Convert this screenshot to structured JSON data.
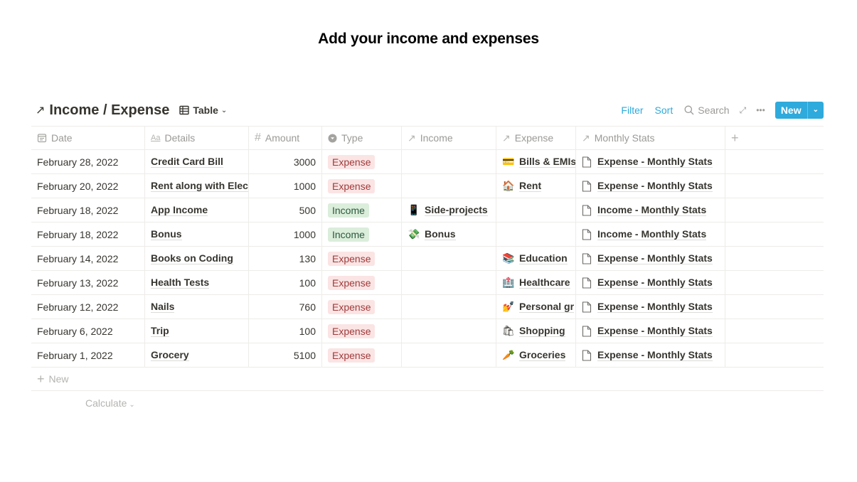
{
  "page_heading": "Add your income and expenses",
  "database": {
    "title": "Income / Expense",
    "view": {
      "label": "Table",
      "icon": "table-icon"
    },
    "toolbar": {
      "filter": "Filter",
      "sort": "Sort",
      "search": "Search",
      "new": "New"
    },
    "columns": [
      {
        "label": "Date",
        "icon": "calendar-icon"
      },
      {
        "label": "Details",
        "icon": "title-text-icon"
      },
      {
        "label": "Amount",
        "icon": "number-icon"
      },
      {
        "label": "Type",
        "icon": "select-icon"
      },
      {
        "label": "Income",
        "icon": "relation-arrow-icon"
      },
      {
        "label": "Expense",
        "icon": "relation-arrow-icon"
      },
      {
        "label": "Monthly Stats",
        "icon": "relation-arrow-icon"
      }
    ],
    "add_column": "+",
    "rows": [
      {
        "date": "February 28, 2022",
        "details": "Credit Card Bill",
        "amount": "3000",
        "type": "Expense",
        "income": null,
        "expense": {
          "emoji": "💳",
          "label": "Bills & EMIs"
        },
        "stats": "Expense - Monthly Stats"
      },
      {
        "date": "February 20, 2022",
        "details": "Rent along with Elec",
        "amount": "1000",
        "type": "Expense",
        "income": null,
        "expense": {
          "emoji": "🏠",
          "label": "Rent"
        },
        "stats": "Expense - Monthly Stats"
      },
      {
        "date": "February 18, 2022",
        "details": "App Income",
        "amount": "500",
        "type": "Income",
        "income": {
          "emoji": "📱",
          "label": "Side-projects"
        },
        "expense": null,
        "stats": "Income - Monthly Stats"
      },
      {
        "date": "February 18, 2022",
        "details": "Bonus",
        "amount": "1000",
        "type": "Income",
        "income": {
          "emoji": "💸",
          "label": "Bonus"
        },
        "expense": null,
        "stats": "Income - Monthly Stats"
      },
      {
        "date": "February 14, 2022",
        "details": "Books on Coding",
        "amount": "130",
        "type": "Expense",
        "income": null,
        "expense": {
          "emoji": "📚",
          "label": "Education"
        },
        "stats": "Expense - Monthly Stats"
      },
      {
        "date": "February 13, 2022",
        "details": "Health Tests",
        "amount": "100",
        "type": "Expense",
        "income": null,
        "expense": {
          "emoji": "🏥",
          "label": "Healthcare"
        },
        "stats": "Expense - Monthly Stats"
      },
      {
        "date": "February 12, 2022",
        "details": "Nails",
        "amount": "760",
        "type": "Expense",
        "income": null,
        "expense": {
          "emoji": "💅",
          "label": "Personal gr"
        },
        "stats": "Expense - Monthly Stats"
      },
      {
        "date": "February 6, 2022",
        "details": "Trip",
        "amount": "100",
        "type": "Expense",
        "income": null,
        "expense": {
          "emoji": "🛍",
          "label": "Shopping"
        },
        "stats": "Expense - Monthly Stats"
      },
      {
        "date": "February 1, 2022",
        "details": "Grocery",
        "amount": "5100",
        "type": "Expense",
        "income": null,
        "expense": {
          "emoji": "🥕",
          "label": "Groceries"
        },
        "stats": "Expense - Monthly Stats"
      }
    ],
    "new_row_label": "New",
    "calculate_label": "Calculate"
  },
  "colors": {
    "accent": "#2eaadc",
    "expense_tag_bg": "#fbe4e4",
    "expense_tag_text": "#9e3b3b",
    "income_tag_bg": "#dbeddb",
    "income_tag_text": "#2b593f"
  }
}
